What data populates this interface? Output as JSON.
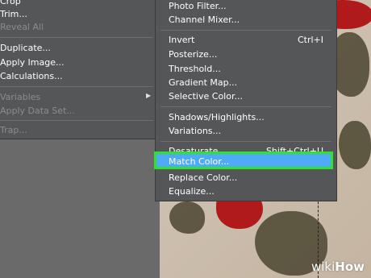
{
  "left_menu": {
    "items": [
      {
        "label": "Crop",
        "enabled": true
      },
      {
        "label": "Trim...",
        "enabled": true
      },
      {
        "label": "Reveal All",
        "enabled": false
      },
      {
        "label": "Duplicate...",
        "enabled": true
      },
      {
        "label": "Apply Image...",
        "enabled": true
      },
      {
        "label": "Calculations...",
        "enabled": true
      },
      {
        "label": "Variables",
        "enabled": false,
        "submenu": true
      },
      {
        "label": "Apply Data Set...",
        "enabled": false
      },
      {
        "label": "Trap...",
        "enabled": false
      }
    ]
  },
  "adjustments_menu": {
    "items": [
      {
        "label": "Photo Filter..."
      },
      {
        "label": "Channel Mixer..."
      },
      {
        "label": "Invert",
        "shortcut": "Ctrl+I"
      },
      {
        "label": "Posterize..."
      },
      {
        "label": "Threshold..."
      },
      {
        "label": "Gradient Map..."
      },
      {
        "label": "Selective Color..."
      },
      {
        "label": "Shadows/Highlights..."
      },
      {
        "label": "Variations..."
      },
      {
        "label": "Desaturate",
        "shortcut": "Shift+Ctrl+U"
      },
      {
        "label": "Match Color...",
        "highlighted": true
      },
      {
        "label": "Replace Color..."
      },
      {
        "label": "Equalize..."
      }
    ]
  },
  "watermark": {
    "prefix": "wiki",
    "suffix": "How"
  },
  "colors": {
    "menu_bg": "#555657",
    "highlight": "#4faaf7",
    "highlight_border": "#2ee22e"
  }
}
